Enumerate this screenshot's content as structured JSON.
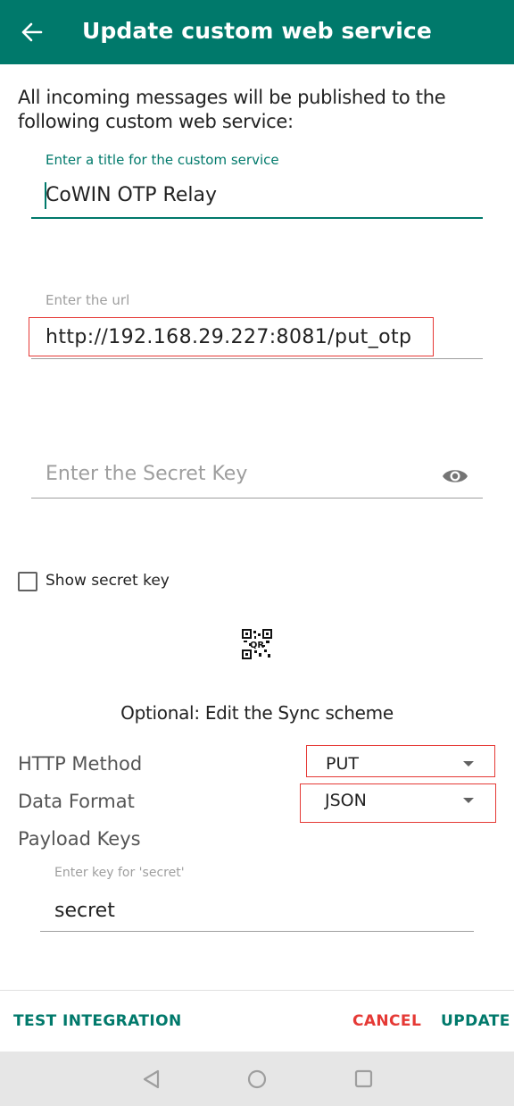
{
  "appbar": {
    "title": "Update custom web service",
    "back_icon": "arrow-back-icon",
    "color": "#00796b"
  },
  "intro_text": "All incoming messages will be published to the following custom web service:",
  "title_field": {
    "label": "Enter a title for the custom service",
    "value": "CoWIN OTP Relay"
  },
  "url_field": {
    "label": "Enter the url",
    "value": "http://192.168.29.227:8081/put_otp"
  },
  "secret_field": {
    "placeholder": "Enter the Secret Key",
    "toggle_icon": "eye-icon"
  },
  "show_secret": {
    "label": "Show secret key",
    "checked": false
  },
  "qr_icon": "qr-code-icon",
  "sync": {
    "heading": "Optional: Edit the Sync scheme",
    "http_method_label": "HTTP Method",
    "http_method_value": "PUT",
    "data_format_label": "Data Format",
    "data_format_value": "JSON",
    "payload_keys_label": "Payload Keys",
    "secret_key_label": "Enter key for 'secret'",
    "secret_key_value": "secret"
  },
  "actions": {
    "test": "TEST INTEGRATION",
    "cancel": "CANCEL",
    "update": "UPDATE"
  },
  "colors": {
    "accent": "#00796b",
    "cancel": "#e53935",
    "highlight": "#e53935"
  },
  "navbar": {
    "back_icon": "nav-back-icon",
    "home_icon": "nav-home-icon",
    "recents_icon": "nav-recents-icon"
  }
}
